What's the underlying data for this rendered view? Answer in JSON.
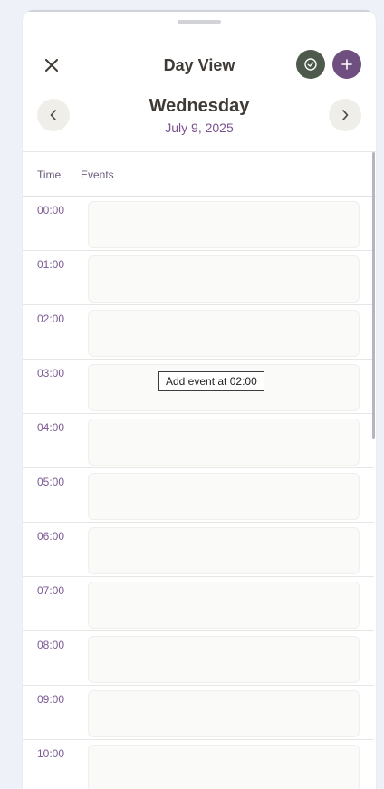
{
  "header": {
    "title": "Day View",
    "weekday": "Wednesday",
    "date": "July 9, 2025"
  },
  "columns": {
    "time": "Time",
    "events": "Events"
  },
  "hours": [
    "00:00",
    "01:00",
    "02:00",
    "03:00",
    "04:00",
    "05:00",
    "06:00",
    "07:00",
    "08:00",
    "09:00",
    "10:00"
  ],
  "tooltip": "Add event at 02:00",
  "colors": {
    "accent_purple": "#6f4f80",
    "complete_green": "#4e5a4c",
    "hour_label": "#7b5a92",
    "title_text": "#3f3a35"
  },
  "icons": {
    "close": "close-icon",
    "complete": "check-circle-icon",
    "add": "plus-icon",
    "prev": "chevron-left-icon",
    "next": "chevron-right-icon"
  }
}
